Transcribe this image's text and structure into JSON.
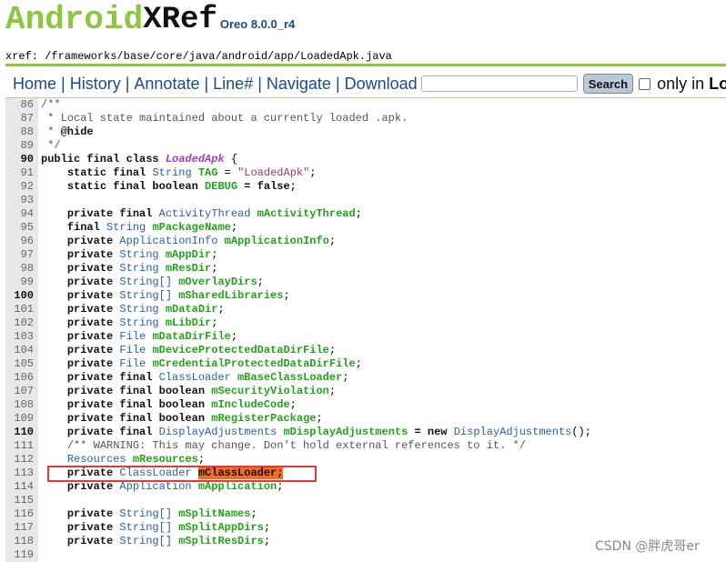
{
  "logo": {
    "android": "Android",
    "xref": "XRef",
    "version": "Oreo 8.0.0_r4"
  },
  "path": {
    "label": "xref:",
    "value": " /frameworks/base/core/java/android/app/LoadedApk.java"
  },
  "nav": {
    "home": "Home",
    "history": "History",
    "annotate": "Annotate",
    "line": "Line#",
    "navigate": "Navigate",
    "download": "Download",
    "sep": "|",
    "search_value": "",
    "search_button": "Search",
    "only_in": "only in",
    "only_in_file": "Loa"
  },
  "code": {
    "l86": "86",
    "l87": "87",
    "l88": "88",
    "l89": "89",
    "l90": "90",
    "l91": "91",
    "l92": "92",
    "l93": "93",
    "l94": "94",
    "l95": "95",
    "l96": "96",
    "l97": "97",
    "l98": "98",
    "l99": "99",
    "l100": "100",
    "l101": "101",
    "l102": "102",
    "l103": "103",
    "l104": "104",
    "l105": "105",
    "l106": "106",
    "l107": "107",
    "l108": "108",
    "l109": "109",
    "l110": "110",
    "l111": "111",
    "l112": "112",
    "l113": "113",
    "l114": "114",
    "l115": "115",
    "l116": "116",
    "l117": "117",
    "l118": "118",
    "l119": "119",
    "c86": "/**",
    "c87": " * Local state maintained about a currently loaded .apk.",
    "c88a": " * ",
    "c88b": "@hide",
    "c89": " */",
    "public_final_class": "public final class ",
    "class_name": "LoadedApk",
    "brace_open": " {",
    "static_final": "static final ",
    "String": "String",
    "TAG": "TAG",
    "tag_eq": " = ",
    "tag_val": "\"LoadedApk\"",
    "semi": ";",
    "static_final_boolean": "static final boolean ",
    "DEBUG": "DEBUG",
    "eq_false": " = false;",
    "private_final": "private final ",
    "ActivityThread": "ActivityThread",
    "mActivityThread": "mActivityThread",
    "final_kw": "final ",
    "mPackageName": "mPackageName",
    "private": "private ",
    "ApplicationInfo": "ApplicationInfo",
    "mApplicationInfo": "mApplicationInfo",
    "mAppDir": "mAppDir",
    "mResDir": "mResDir",
    "StringArr": "String[]",
    "mOverlayDirs": "mOverlayDirs",
    "mSharedLibraries": "mSharedLibraries",
    "mDataDir": "mDataDir",
    "mLibDir": "mLibDir",
    "File": "File",
    "mDataDirFile": "mDataDirFile",
    "mDeviceProtectedDataDirFile": "mDeviceProtectedDataDirFile",
    "mCredentialProtectedDataDirFile": "mCredentialProtectedDataDirFile",
    "ClassLoader": "ClassLoader",
    "mBaseClassLoader": "mBaseClassLoader",
    "private_final_boolean": "private final boolean ",
    "mSecurityViolation": "mSecurityViolation",
    "mIncludeCode": "mIncludeCode",
    "mRegisterPackage": "mRegisterPackage",
    "DisplayAdjustments": "DisplayAdjustments",
    "mDisplayAdjustments": "mDisplayAdjustments",
    "eq_new": " = new ",
    "parens_semi": "();",
    "c111": "/** WARNING: This may change. Don't hold external references to it. */",
    "Resources": "Resources",
    "mResources": "mResources",
    "mClassLoader": "mClassLoader",
    "Application": "Application",
    "mApplication": "mApplication",
    "mSplitNames": "mSplitNames",
    "mSplitAppDirs": "mSplitAppDirs",
    "mSplitResDirs": "mSplitResDirs"
  },
  "colors": {
    "accent_green": "#8dc63f",
    "link_blue": "#1a4a8e",
    "highlight_orange": "#f26b22",
    "box_red": "#e53935"
  },
  "watermark": "CSDN @胖虎哥er"
}
